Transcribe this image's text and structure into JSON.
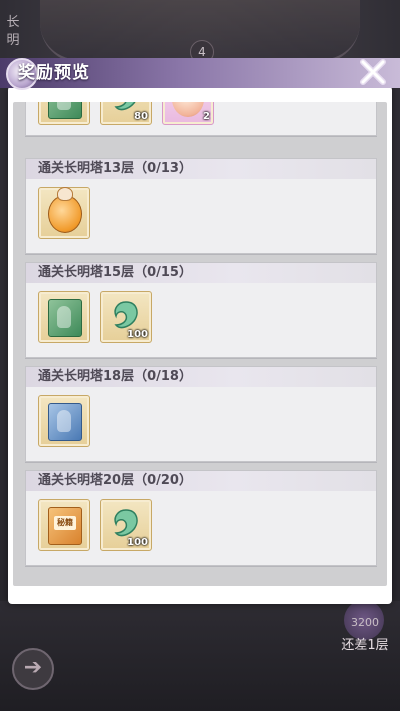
{
  "background": {
    "side_label": "长明",
    "floor_badge": "4",
    "back_icon": "back-arrow-icon",
    "coin_value": "3200",
    "remaining_text": "还差1层"
  },
  "modal": {
    "title": "奖励预览",
    "close_icon": "close-x-icon",
    "accent_color": "#8a76a8"
  },
  "rewards": {
    "partial": {
      "items": [
        {
          "icon": "green-book-icon",
          "qty": ""
        },
        {
          "icon": "jade-token-icon",
          "qty": "80"
        },
        {
          "icon": "peach-icon",
          "qty": "2"
        }
      ]
    },
    "tiers": [
      {
        "label": "通关长明塔13层（0/13）",
        "items": [
          {
            "icon": "cat-medal-icon",
            "qty": ""
          }
        ]
      },
      {
        "label": "通关长明塔15层（0/15）",
        "items": [
          {
            "icon": "green-book-icon",
            "qty": ""
          },
          {
            "icon": "jade-token-icon",
            "qty": "100"
          }
        ]
      },
      {
        "label": "通关长明塔18层（0/18）",
        "items": [
          {
            "icon": "blue-book-icon",
            "qty": ""
          }
        ]
      },
      {
        "label": "通关长明塔20层（0/20）",
        "items": [
          {
            "icon": "secret-book-icon",
            "qty": "",
            "text": "秘籍"
          },
          {
            "icon": "jade-token-icon",
            "qty": "100"
          }
        ]
      }
    ]
  }
}
